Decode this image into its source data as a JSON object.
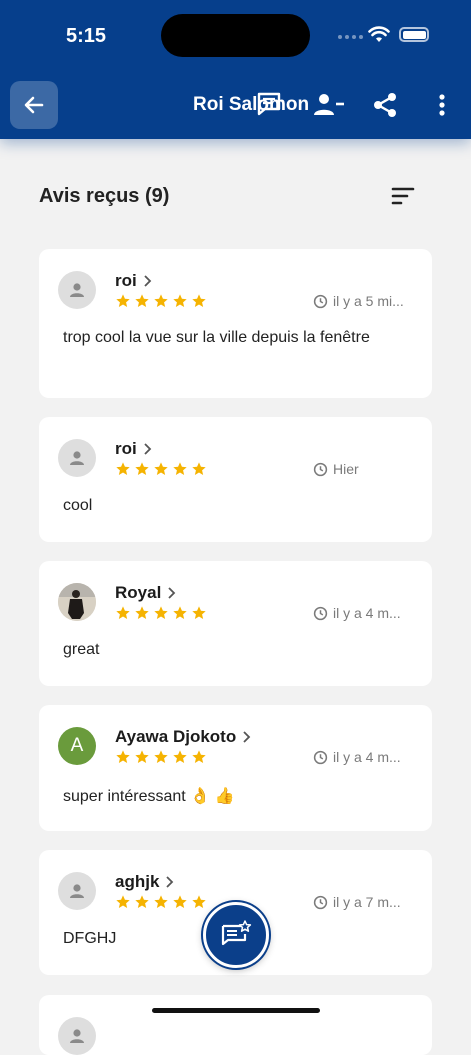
{
  "status_bar": {
    "time": "5:15"
  },
  "header": {
    "title": "Roi Salomon"
  },
  "section": {
    "title": "Avis reçus (9)"
  },
  "reviews": [
    {
      "name": "roi",
      "avatar": "person",
      "stars": 5,
      "time": "il y a 5 mi...",
      "text": "trop cool la vue sur la ville depuis la fenêtre"
    },
    {
      "name": "roi",
      "avatar": "person",
      "stars": 5,
      "time": "Hier",
      "text": "cool"
    },
    {
      "name": "Royal",
      "avatar": "photo",
      "stars": 5,
      "time": "il y a 4 m...",
      "text": "great"
    },
    {
      "name": "Ayawa Djokoto",
      "avatar": "letter",
      "avatar_letter": "A",
      "stars": 5,
      "time": "il y a 4 m...",
      "text": "super intéressant 👌 👍"
    },
    {
      "name": "aghjk",
      "avatar": "person",
      "stars": 5,
      "time": "il y a 7 m...",
      "text": "DFGHJ"
    }
  ],
  "colors": {
    "header": "#063f8c",
    "star": "#f5b301",
    "avatar_letter_bg": "#6a9b3c"
  }
}
